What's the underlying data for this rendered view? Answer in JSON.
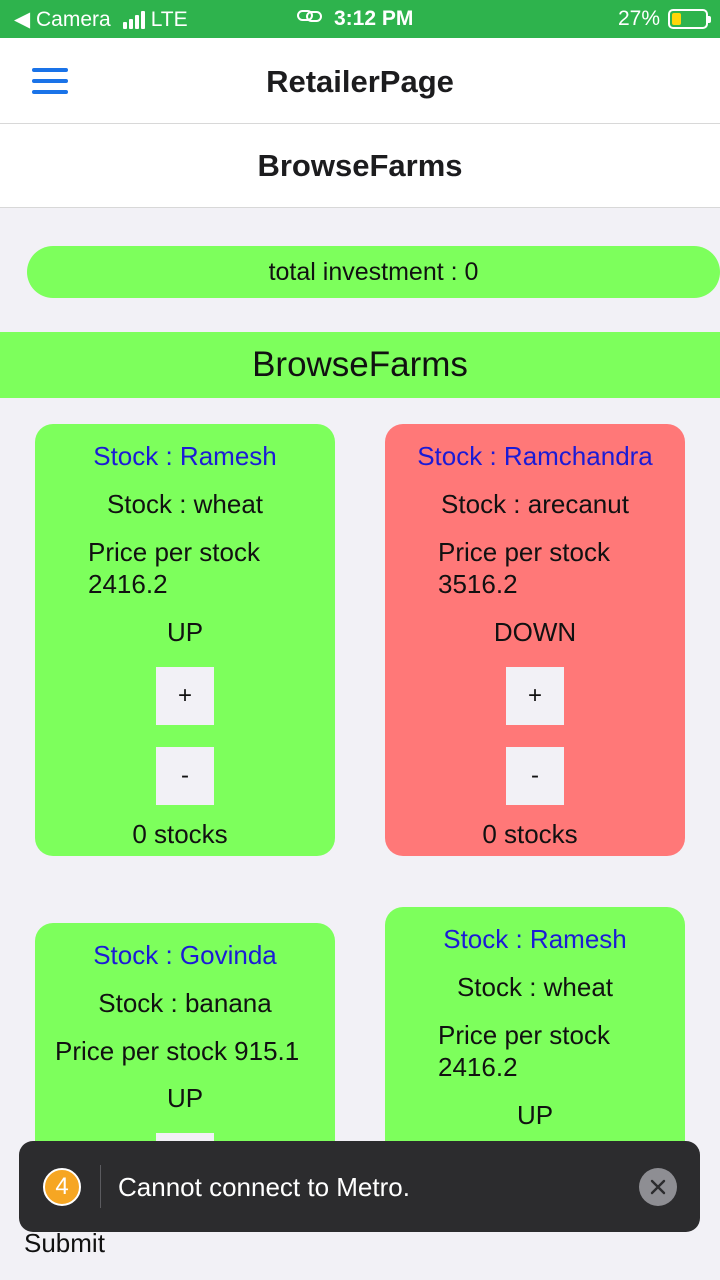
{
  "status_bar": {
    "back_app": "◀ Camera",
    "network": "LTE",
    "time": "3:12 PM",
    "battery": "27%"
  },
  "header": {
    "title": "RetailerPage",
    "menu_icon": "hamburger-menu-icon"
  },
  "sub_header": {
    "title": "BrowseFarms"
  },
  "investment": {
    "label": "total investment : 0"
  },
  "section": {
    "title": "BrowseFarms"
  },
  "cards": [
    {
      "farmer": "Stock : Ramesh",
      "crop": "Stock : wheat",
      "price": "Price per stock 2416.2",
      "trend": "UP",
      "plus": "+",
      "minus": "-",
      "count": "0 stocks",
      "color": "#7dff5c"
    },
    {
      "farmer": "Stock : Ramchandra",
      "crop": "Stock : arecanut",
      "price": "Price per stock 3516.2",
      "trend": "DOWN",
      "plus": "+",
      "minus": "-",
      "count": "0 stocks",
      "color": "#ff7878"
    },
    {
      "farmer": "Stock : Govinda",
      "crop": "Stock : banana",
      "price": "Price per stock 915.1",
      "trend": "UP",
      "plus": "+",
      "color": "#7dff5c"
    },
    {
      "farmer": "Stock : Ramesh",
      "crop": "Stock : wheat",
      "price": "Price per stock 2416.2",
      "trend": "UP",
      "color": "#7dff5c"
    }
  ],
  "submit": {
    "label": "Submit"
  },
  "toast": {
    "badge": "4",
    "message": "Cannot connect to Metro.",
    "close_icon": "close-icon"
  },
  "colors": {
    "status_bar": "#2eb34d",
    "accent": "#1a73e8",
    "card_up": "#7dff5c",
    "card_down": "#ff7878",
    "farmer_text": "#1b1bd6"
  }
}
